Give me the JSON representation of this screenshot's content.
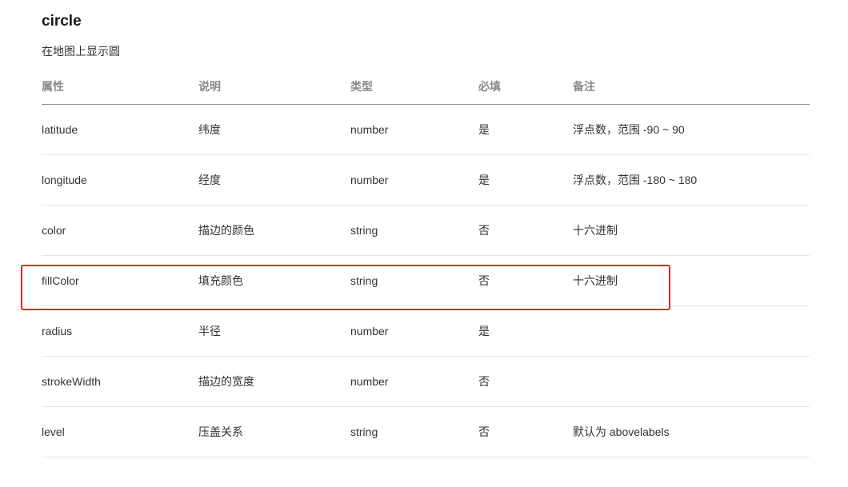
{
  "doc": {
    "title": "circle",
    "description": "在地图上显示圆"
  },
  "table": {
    "headers": [
      "属性",
      "说明",
      "类型",
      "必填",
      "备注"
    ],
    "rows": [
      [
        "latitude",
        "纬度",
        "number",
        "是",
        "浮点数，范围 -90 ~ 90"
      ],
      [
        "longitude",
        "经度",
        "number",
        "是",
        "浮点数，范围 -180 ~ 180"
      ],
      [
        "color",
        "描边的颜色",
        "string",
        "否",
        "十六进制"
      ],
      [
        "fillColor",
        "填充颜色",
        "string",
        "否",
        "十六进制"
      ],
      [
        "radius",
        "半径",
        "number",
        "是",
        ""
      ],
      [
        "strokeWidth",
        "描边的宽度",
        "number",
        "否",
        ""
      ],
      [
        "level",
        "压盖关系",
        "string",
        "否",
        "默认为 abovelabels"
      ]
    ],
    "highlighted_row": "fillColor"
  },
  "colors": {
    "highlight_border": "#e8231c",
    "header_text": "#8a8a8a",
    "body_text": "#333333",
    "row_divider": "#e6e6e6"
  }
}
